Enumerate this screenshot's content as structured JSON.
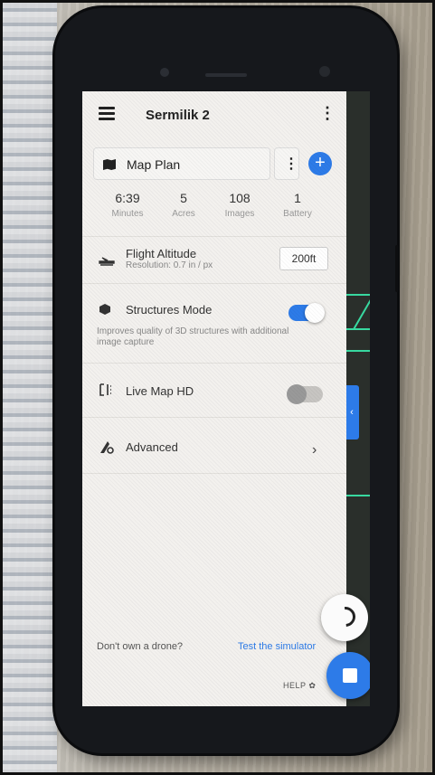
{
  "header": {
    "title": "Sermilik 2",
    "kebab_glyph": "⋮"
  },
  "plan": {
    "label": "Map Plan",
    "kebab_glyph": "⋮",
    "add_glyph": "+"
  },
  "stats": [
    {
      "value": "6:39",
      "label": "Minutes"
    },
    {
      "value": "5",
      "label": "Acres"
    },
    {
      "value": "108",
      "label": "Images"
    },
    {
      "value": "1",
      "label": "Battery"
    }
  ],
  "settings": {
    "altitude": {
      "label": "Flight Altitude",
      "resolution": "Resolution: 0.7 in / px",
      "value": "200ft",
      "icon": "plane-icon"
    },
    "structures": {
      "label": "Structures Mode",
      "description": "Improves quality of 3D structures with additional image capture",
      "enabled": true,
      "icon": "cube-icon"
    },
    "livemap": {
      "label": "Live Map HD",
      "enabled": false,
      "icon": "live-map-icon"
    },
    "advanced": {
      "label": "Advanced",
      "icon": "advanced-settings-icon",
      "chevron_glyph": "›"
    }
  },
  "footer": {
    "prompt": "Don't own a drone?",
    "link": "Test the simulator",
    "help": "HELP"
  },
  "colors": {
    "accent": "#2d7be8",
    "map_lines": "#38d9a0"
  }
}
